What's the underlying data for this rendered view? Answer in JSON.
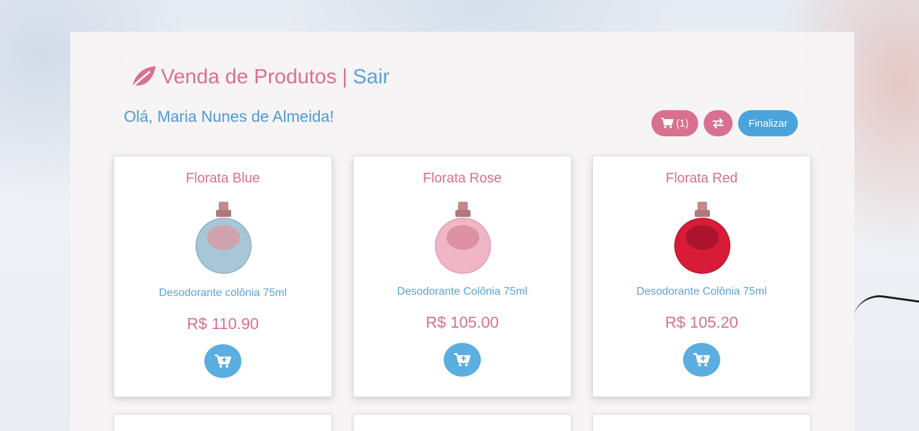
{
  "header": {
    "title": "Venda de Produtos",
    "separator": "|",
    "logout": "Sair",
    "greeting": "Olá, Maria Nunes de Almeida!"
  },
  "actions": {
    "cart_count": "(1)",
    "finish": "Finalizar"
  },
  "icons": {
    "brand": "leaf-icon",
    "cart": "shopping-cart-icon",
    "swap": "exchange-icon",
    "add": "cart-plus-icon"
  },
  "colors": {
    "pink": "#d9708f",
    "blue": "#4aa3db"
  },
  "products": [
    {
      "name": "Florata Blue",
      "description": "Desodorante colônia 75ml",
      "price": "R$ 110.90",
      "bottle_color": "#a7c6d6"
    },
    {
      "name": "Florata Rose",
      "description": "Desodorante Colônia 75ml",
      "price": "R$ 105.00",
      "bottle_color": "#f1b6c6"
    },
    {
      "name": "Florata Red",
      "description": "Desodorante Colônia 75ml",
      "price": "R$ 105.20",
      "bottle_color": "#d81c37"
    }
  ]
}
